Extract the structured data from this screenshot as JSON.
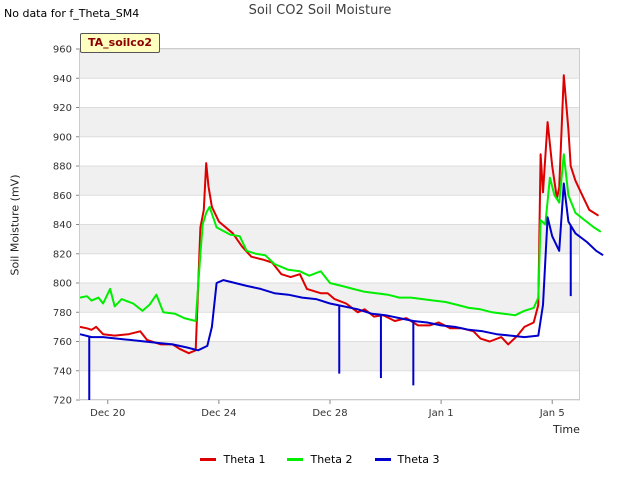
{
  "header": {
    "no_data_note": "No data for f_Theta_SM4",
    "badge": "TA_soilco2"
  },
  "chart_data": {
    "type": "line",
    "title": "Soil CO2 Soil Moisture",
    "xlabel": "Time",
    "ylabel": "Soil Moisture (mV)",
    "ylim": [
      720,
      960
    ],
    "yticks": [
      720,
      740,
      760,
      780,
      800,
      820,
      840,
      860,
      880,
      900,
      920,
      940,
      960
    ],
    "xlim": [
      "2023-12-19",
      "2024-01-06"
    ],
    "xticks": [
      {
        "label": "Dec 20",
        "t": "2023-12-20"
      },
      {
        "label": "Dec 24",
        "t": "2023-12-24"
      },
      {
        "label": "Dec 28",
        "t": "2023-12-28"
      },
      {
        "label": "Jan 1",
        "t": "2024-01-01"
      },
      {
        "label": "Jan 5",
        "t": "2024-01-05"
      }
    ],
    "grid": true,
    "legend_position": "bottom",
    "series": [
      {
        "name": "Theta 1",
        "color": "#dd0000",
        "points": [
          [
            "2023-12-19T00:00",
            770
          ],
          [
            "2023-12-19T06:00",
            769
          ],
          [
            "2023-12-19T10:00",
            768
          ],
          [
            "2023-12-19T14:00",
            770
          ],
          [
            "2023-12-19T20:00",
            765
          ],
          [
            "2023-12-20T06:00",
            764
          ],
          [
            "2023-12-20T18:00",
            765
          ],
          [
            "2023-12-21T04:00",
            767
          ],
          [
            "2023-12-21T10:00",
            761
          ],
          [
            "2023-12-21T22:00",
            758
          ],
          [
            "2023-12-22T08:00",
            758
          ],
          [
            "2023-12-22T14:00",
            755
          ],
          [
            "2023-12-22T22:00",
            752
          ],
          [
            "2023-12-23T04:00",
            754
          ],
          [
            "2023-12-23T08:00",
            838
          ],
          [
            "2023-12-23T11:00",
            850
          ],
          [
            "2023-12-23T13:00",
            882
          ],
          [
            "2023-12-23T15:00",
            866
          ],
          [
            "2023-12-23T18:00",
            852
          ],
          [
            "2023-12-24T00:00",
            842
          ],
          [
            "2023-12-24T12:00",
            834
          ],
          [
            "2023-12-24T20:00",
            825
          ],
          [
            "2023-12-25T04:00",
            818
          ],
          [
            "2023-12-25T14:00",
            816
          ],
          [
            "2023-12-25T22:00",
            814
          ],
          [
            "2023-12-26T06:00",
            806
          ],
          [
            "2023-12-26T14:00",
            804
          ],
          [
            "2023-12-26T22:00",
            806
          ],
          [
            "2023-12-27T04:00",
            796
          ],
          [
            "2023-12-27T16:00",
            793
          ],
          [
            "2023-12-27T22:00",
            793
          ],
          [
            "2023-12-28T04:00",
            789
          ],
          [
            "2023-12-28T14:00",
            786
          ],
          [
            "2023-12-29T00:00",
            780
          ],
          [
            "2023-12-29T06:00",
            782
          ],
          [
            "2023-12-29T14:00",
            777
          ],
          [
            "2023-12-29T22:00",
            778
          ],
          [
            "2023-12-30T08:00",
            774
          ],
          [
            "2023-12-30T18:00",
            776
          ],
          [
            "2023-12-31T04:00",
            771
          ],
          [
            "2023-12-31T14:00",
            771
          ],
          [
            "2023-12-31T22:00",
            773
          ],
          [
            "2024-01-01T08:00",
            769
          ],
          [
            "2024-01-01T18:00",
            769
          ],
          [
            "2024-01-02T04:00",
            767
          ],
          [
            "2024-01-02T10:00",
            762
          ],
          [
            "2024-01-02T18:00",
            760
          ],
          [
            "2024-01-03T04:00",
            763
          ],
          [
            "2024-01-03T10:00",
            758
          ],
          [
            "2024-01-03T18:00",
            764
          ],
          [
            "2024-01-04T00:00",
            770
          ],
          [
            "2024-01-04T08:00",
            773
          ],
          [
            "2024-01-04T12:00",
            785
          ],
          [
            "2024-01-04T14:00",
            888
          ],
          [
            "2024-01-04T16:00",
            862
          ],
          [
            "2024-01-04T20:00",
            910
          ],
          [
            "2024-01-05T00:00",
            880
          ],
          [
            "2024-01-05T04:00",
            858
          ],
          [
            "2024-01-05T06:00",
            865
          ],
          [
            "2024-01-05T10:00",
            942
          ],
          [
            "2024-01-05T14:00",
            905
          ],
          [
            "2024-01-05T16:00",
            880
          ],
          [
            "2024-01-05T20:00",
            870
          ],
          [
            "2024-01-06T02:00",
            860
          ],
          [
            "2024-01-06T08:00",
            850
          ],
          [
            "2024-01-06T16:00",
            846
          ]
        ]
      },
      {
        "name": "Theta 2",
        "color": "#00ee00",
        "points": [
          [
            "2023-12-19T00:00",
            790
          ],
          [
            "2023-12-19T06:00",
            791
          ],
          [
            "2023-12-19T10:00",
            788
          ],
          [
            "2023-12-19T16:00",
            790
          ],
          [
            "2023-12-19T20:00",
            786
          ],
          [
            "2023-12-20T02:00",
            796
          ],
          [
            "2023-12-20T06:00",
            784
          ],
          [
            "2023-12-20T12:00",
            789
          ],
          [
            "2023-12-20T22:00",
            786
          ],
          [
            "2023-12-21T06:00",
            781
          ],
          [
            "2023-12-21T12:00",
            785
          ],
          [
            "2023-12-21T18:00",
            792
          ],
          [
            "2023-12-22T00:00",
            780
          ],
          [
            "2023-12-22T10:00",
            779
          ],
          [
            "2023-12-22T18:00",
            776
          ],
          [
            "2023-12-23T04:00",
            774
          ],
          [
            "2023-12-23T08:00",
            820
          ],
          [
            "2023-12-23T10:00",
            840
          ],
          [
            "2023-12-23T13:00",
            848
          ],
          [
            "2023-12-23T16:00",
            852
          ],
          [
            "2023-12-23T22:00",
            838
          ],
          [
            "2023-12-24T10:00",
            833
          ],
          [
            "2023-12-24T18:00",
            832
          ],
          [
            "2023-12-25T00:00",
            822
          ],
          [
            "2023-12-25T08:00",
            820
          ],
          [
            "2023-12-25T16:00",
            819
          ],
          [
            "2023-12-26T00:00",
            813
          ],
          [
            "2023-12-26T12:00",
            809
          ],
          [
            "2023-12-26T22:00",
            808
          ],
          [
            "2023-12-27T06:00",
            805
          ],
          [
            "2023-12-27T16:00",
            808
          ],
          [
            "2023-12-28T00:00",
            800
          ],
          [
            "2023-12-28T10:00",
            798
          ],
          [
            "2023-12-28T20:00",
            796
          ],
          [
            "2023-12-29T06:00",
            794
          ],
          [
            "2023-12-29T16:00",
            793
          ],
          [
            "2023-12-30T02:00",
            792
          ],
          [
            "2023-12-30T12:00",
            790
          ],
          [
            "2023-12-30T22:00",
            790
          ],
          [
            "2023-12-31T08:00",
            789
          ],
          [
            "2023-12-31T18:00",
            788
          ],
          [
            "2024-01-01T04:00",
            787
          ],
          [
            "2024-01-01T14:00",
            785
          ],
          [
            "2024-01-02T00:00",
            783
          ],
          [
            "2024-01-02T10:00",
            782
          ],
          [
            "2024-01-02T20:00",
            780
          ],
          [
            "2024-01-03T06:00",
            779
          ],
          [
            "2024-01-03T16:00",
            778
          ],
          [
            "2024-01-04T00:00",
            781
          ],
          [
            "2024-01-04T08:00",
            783
          ],
          [
            "2024-01-04T12:00",
            790
          ],
          [
            "2024-01-04T14:00",
            843
          ],
          [
            "2024-01-04T18:00",
            840
          ],
          [
            "2024-01-04T22:00",
            872
          ],
          [
            "2024-01-05T02:00",
            860
          ],
          [
            "2024-01-05T06:00",
            855
          ],
          [
            "2024-01-05T10:00",
            888
          ],
          [
            "2024-01-05T14:00",
            860
          ],
          [
            "2024-01-05T20:00",
            848
          ],
          [
            "2024-01-06T04:00",
            843
          ],
          [
            "2024-01-06T12:00",
            838
          ],
          [
            "2024-01-06T18:00",
            835
          ]
        ]
      },
      {
        "name": "Theta 3",
        "color": "#0000cc",
        "points": [
          [
            "2023-12-19T00:00",
            765
          ],
          [
            "2023-12-19T10:00",
            763
          ],
          [
            "2023-12-19T20:00",
            763
          ],
          [
            "2023-12-20T08:00",
            762
          ],
          [
            "2023-12-20T20:00",
            761
          ],
          [
            "2023-12-21T08:00",
            760
          ],
          [
            "2023-12-21T20:00",
            759
          ],
          [
            "2023-12-22T08:00",
            758
          ],
          [
            "2023-12-22T20:00",
            756
          ],
          [
            "2023-12-23T06:00",
            754
          ],
          [
            "2023-12-23T14:00",
            757
          ],
          [
            "2023-12-23T18:00",
            770
          ],
          [
            "2023-12-23T22:00",
            800
          ],
          [
            "2023-12-24T04:00",
            802
          ],
          [
            "2023-12-24T14:00",
            800
          ],
          [
            "2023-12-25T00:00",
            798
          ],
          [
            "2023-12-25T12:00",
            796
          ],
          [
            "2023-12-26T00:00",
            793
          ],
          [
            "2023-12-26T12:00",
            792
          ],
          [
            "2023-12-27T00:00",
            790
          ],
          [
            "2023-12-27T12:00",
            789
          ],
          [
            "2023-12-28T00:00",
            786
          ],
          [
            "2023-12-28T12:00",
            784
          ],
          [
            "2023-12-29T00:00",
            782
          ],
          [
            "2023-12-29T12:00",
            779
          ],
          [
            "2023-12-30T00:00",
            778
          ],
          [
            "2023-12-30T12:00",
            776
          ],
          [
            "2023-12-31T00:00",
            774
          ],
          [
            "2023-12-31T12:00",
            773
          ],
          [
            "2024-01-01T00:00",
            771
          ],
          [
            "2024-01-01T12:00",
            770
          ],
          [
            "2024-01-02T00:00",
            768
          ],
          [
            "2024-01-02T12:00",
            767
          ],
          [
            "2024-01-03T00:00",
            765
          ],
          [
            "2024-01-03T12:00",
            764
          ],
          [
            "2024-01-04T00:00",
            763
          ],
          [
            "2024-01-04T12:00",
            764
          ],
          [
            "2024-01-04T16:00",
            785
          ],
          [
            "2024-01-04T20:00",
            845
          ],
          [
            "2024-01-05T00:00",
            832
          ],
          [
            "2024-01-05T06:00",
            822
          ],
          [
            "2024-01-05T10:00",
            868
          ],
          [
            "2024-01-05T14:00",
            842
          ],
          [
            "2024-01-05T20:00",
            834
          ],
          [
            "2024-01-06T06:00",
            828
          ],
          [
            "2024-01-06T14:00",
            822
          ],
          [
            "2024-01-06T20:00",
            819
          ]
        ],
        "dropouts": [
          [
            "2023-12-19T08:00",
            720
          ],
          [
            "2023-12-28T08:00",
            738
          ],
          [
            "2023-12-29T20:00",
            735
          ],
          [
            "2023-12-31T00:00",
            730
          ],
          [
            "2024-01-05T16:00",
            791
          ]
        ]
      }
    ]
  }
}
